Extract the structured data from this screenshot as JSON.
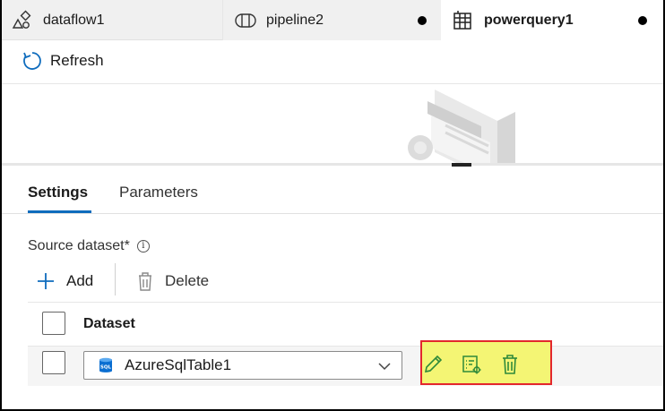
{
  "tabs": [
    {
      "label": "dataflow1",
      "icon": "dataflow-icon",
      "unsaved": false
    },
    {
      "label": "pipeline2",
      "icon": "pipeline-icon",
      "unsaved": true
    },
    {
      "label": "powerquery1",
      "icon": "powerquery-icon",
      "unsaved": true,
      "active": true
    }
  ],
  "toolbar": {
    "refresh_label": "Refresh"
  },
  "settings": {
    "tabs": {
      "settings": "Settings",
      "parameters": "Parameters"
    },
    "source_label": "Source dataset*",
    "info_glyph": "i",
    "add_label": "Add",
    "delete_label": "Delete",
    "table": {
      "header": "Dataset",
      "rows": [
        {
          "value": "AzureSqlTable1",
          "icon": "sql-icon",
          "icon_text": "SQL"
        }
      ]
    }
  },
  "colors": {
    "accent": "#0f6cbd",
    "highlight_fill": "#f4f574",
    "highlight_border": "#e3272d",
    "row_action_icon": "#2f8a3a"
  }
}
